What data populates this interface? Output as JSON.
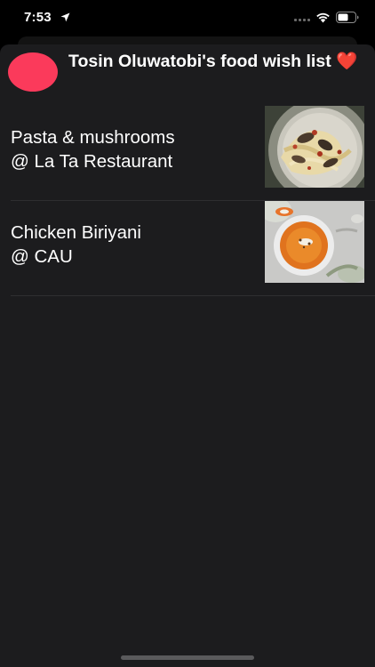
{
  "status_bar": {
    "time": "7:53",
    "icons": [
      "location-arrow-icon",
      "signal-icon",
      "wifi-icon",
      "battery-icon"
    ]
  },
  "header": {
    "title": "Tosin Oluwatobi's food wish list ❤️",
    "avatar_color": "#fb3a5b"
  },
  "items": [
    {
      "line1": "Pasta & mushrooms",
      "line2": "@ La Ta Restaurant",
      "image_icon": "pasta-photo"
    },
    {
      "line1": "Chicken Biriyani",
      "line2": "@ CAU",
      "image_icon": "soup-photo"
    }
  ],
  "colors": {
    "background": "#000000",
    "sheet": "#1c1c1e",
    "separator": "#2e2e30",
    "accent": "#fb3a5b"
  }
}
